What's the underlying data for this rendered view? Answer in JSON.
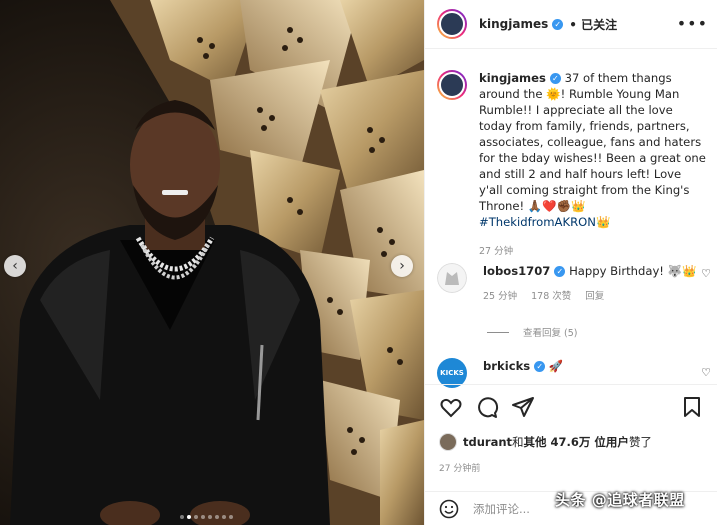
{
  "header": {
    "username": "kingjames",
    "verified_glyph": "✓",
    "follow_label": "• 已关注",
    "more_glyph": "•••"
  },
  "caption": {
    "username": "kingjames",
    "text_1": "37 of them thangs around the ",
    "crown_emoji": "🌞",
    "text_2": "! Rumble Young Man Rumble!! I appreciate all the love today from family, friends, partners, associates, colleague, fans and haters for the bday wishes!! Been a great one and still 2 and half hours left! Love y'all coming straight from the King's Throne! ",
    "emojis": "🙏🏾❤️✊🏾👑",
    "hashtag": "#ThekidfromAKRON",
    "hashtag_emoji": "👑",
    "time": "27 分钟"
  },
  "comments": [
    {
      "username": "lobos1707",
      "text": "Happy Birthday! 🐺👑",
      "time": "25 分钟",
      "likes": "178 次赞",
      "reply": "回复",
      "view_replies": "查看回复 (5)"
    },
    {
      "username": "brkicks",
      "text": "🚀",
      "avatar_text": "KICKS"
    }
  ],
  "likes": {
    "user": "tdurant",
    "and": " 和 ",
    "others": "其他 47.6万 位用户",
    "liked": " 赞了"
  },
  "post_time": "27 分钟前",
  "add_comment": {
    "placeholder": "添加评论..."
  },
  "watermark": "头条 @追球者联盟",
  "nav": {
    "prev": "‹",
    "next": "›"
  },
  "colors": {
    "verified": "#3897f0",
    "hashtag": "#00376b",
    "muted": "#8e8e8e"
  },
  "icons": [
    "heart-icon",
    "comment-icon",
    "share-icon",
    "bookmark-icon",
    "emoji-icon",
    "more-icon"
  ]
}
